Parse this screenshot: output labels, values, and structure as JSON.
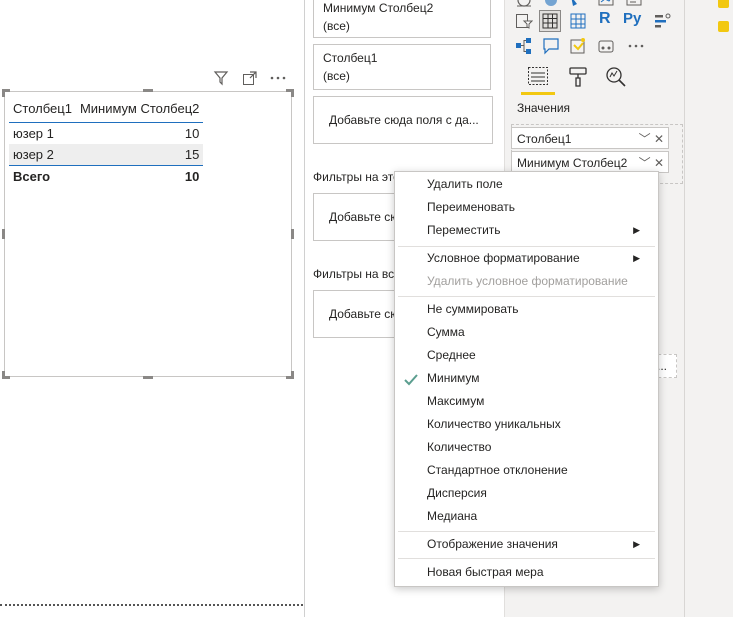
{
  "visual": {
    "columns": [
      "Столбец1",
      "Минимум Столбец2"
    ],
    "rows": [
      {
        "c1": "юзер 1",
        "c2": "10"
      },
      {
        "c1": "юзер 2",
        "c2": "15"
      }
    ],
    "total": {
      "label": "Всего",
      "value": "10"
    },
    "header_icons": [
      "filter-icon",
      "focus-mode-icon",
      "more-options-icon"
    ]
  },
  "filters": {
    "wells": [
      {
        "line1": "Минимум Столбец2",
        "line2": "(все)"
      },
      {
        "line1": "Столбец1",
        "line2": "(все)"
      },
      {
        "line1": "Добавьте сюда поля с да...",
        "line2": ""
      }
    ],
    "page_section": "Фильтры на это",
    "page_add": "Добавьте сю",
    "all_section": "Фильтры на вс",
    "all_add": "Добавьте сю"
  },
  "viz": {
    "values_label": "Значения",
    "fields": [
      "Столбец1",
      "Минимум Столбец2"
    ],
    "more_label": "...",
    "tabs": [
      "fields-tab-icon",
      "format-tab-icon",
      "analytics-tab-icon"
    ]
  },
  "menu": {
    "items_top": [
      "Удалить поле",
      "Переименовать",
      "Переместить"
    ],
    "items_cond": [
      "Условное форматирование",
      "Удалить условное форматирование"
    ],
    "items_agg": [
      "Не суммировать",
      "Сумма",
      "Среднее",
      "Минимум",
      "Максимум",
      "Количество уникальных",
      "Количество",
      "Стандартное отклонение",
      "Дисперсия",
      "Медиана"
    ],
    "show_value": "Отображение значения",
    "quick_measure": "Новая быстрая мера",
    "selected": "Минимум",
    "arrow": "▶"
  },
  "colors": {
    "accent": "#1f6fbe",
    "check": "#5b9e8f",
    "highlight": "#f2c811"
  }
}
